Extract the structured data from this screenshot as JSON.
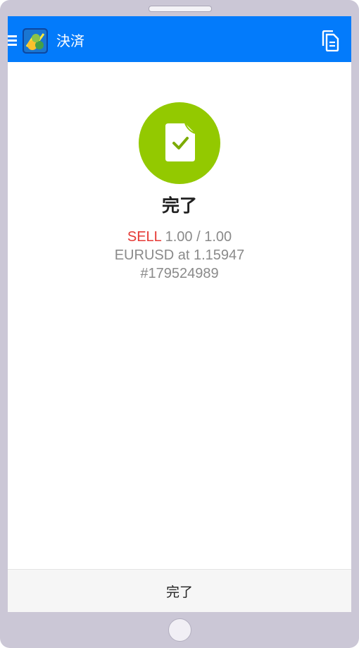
{
  "app_bar": {
    "title": "決済",
    "menu_icon": "hamburger-icon",
    "logo_icon": "metatrader-logo-icon",
    "copy_icon": "copy-document-icon",
    "color": "#037bfb"
  },
  "result": {
    "icon": "document-check-icon",
    "badge_color": "#93c900",
    "title": "完了",
    "side": "SELL",
    "side_color": "#e53935",
    "volume": "1.00 / 1.00",
    "symbol_line": "EURUSD at 1.15947",
    "ticket": "#179524989"
  },
  "footer": {
    "done_label": "完了"
  }
}
